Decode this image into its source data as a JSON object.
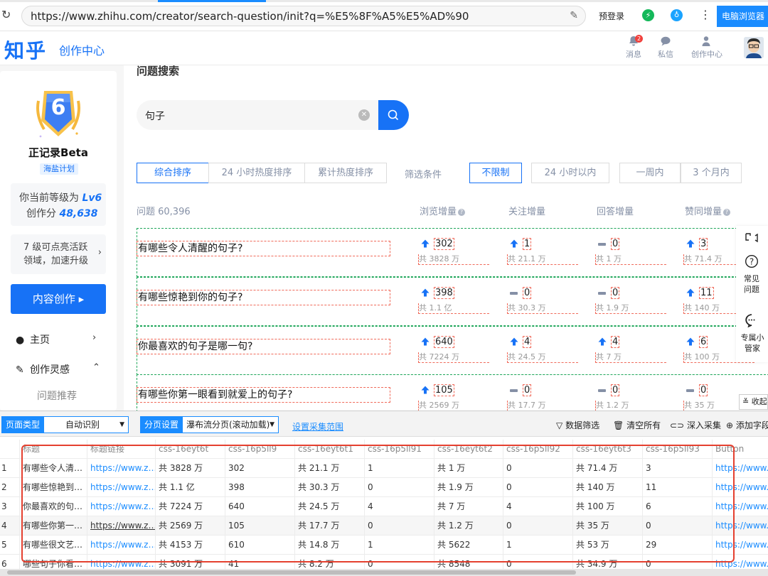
{
  "browser": {
    "url": "https://www.zhihu.com/creator/search-question/init?q=%E5%8F%A5%E5%AD%90",
    "prelogin": "预登录",
    "ext1": "⚡",
    "ext2": "♁",
    "menu": "⋮",
    "pc_browser": "电脑浏览器"
  },
  "header": {
    "logo": "知乎",
    "creator_center": "创作中心",
    "notifications": "消息",
    "notification_count": "2",
    "messages": "私信",
    "creator_link": "创作中心"
  },
  "sidebar": {
    "medal_level": "6",
    "level_title": "正记录Beta",
    "plan": "海盐计划",
    "level_prefix": "你当前等级为",
    "level_value": "Lv6",
    "score_prefix": "创作分",
    "score_value": "48,638",
    "tip": "7 级可点亮活跃领域，加速升级",
    "create_button": "内容创作 ▸",
    "nav_home": "主页",
    "nav_inspiration": "创作灵感",
    "nav_question_recommend": "问题推荐"
  },
  "main": {
    "title": "问题搜索",
    "search_value": "句子",
    "sort_tabs": [
      "综合排序",
      "24 小时热度排序",
      "累计热度排序"
    ],
    "filter_label": "筛选条件",
    "time_filters": [
      "不限制",
      "24 小时以内",
      "一周内",
      "3 个月内"
    ],
    "question_count": "问题 60,396",
    "columns": [
      "浏览增量",
      "关注增量",
      "回答增量",
      "赞同增量"
    ],
    "questions": [
      {
        "title": "有哪些令人清醒的句子?",
        "stats": [
          {
            "trend": "up",
            "value": "302",
            "total": "共 3828 万"
          },
          {
            "trend": "up",
            "value": "1",
            "total": "共 21.1 万"
          },
          {
            "trend": "flat",
            "value": "0",
            "total": "共 1 万"
          },
          {
            "trend": "up",
            "value": "3",
            "total": "共 71.4 万"
          }
        ]
      },
      {
        "title": "有哪些惊艳到你的句子?",
        "stats": [
          {
            "trend": "up",
            "value": "398",
            "total": "共 1.1 亿"
          },
          {
            "trend": "flat",
            "value": "0",
            "total": "共 30.3 万"
          },
          {
            "trend": "flat",
            "value": "0",
            "total": "共 1.9 万"
          },
          {
            "trend": "up",
            "value": "11",
            "total": "共 140 万"
          }
        ]
      },
      {
        "title": "你最喜欢的句子是哪一句?",
        "stats": [
          {
            "trend": "up",
            "value": "640",
            "total": "共 7224 万"
          },
          {
            "trend": "up",
            "value": "4",
            "total": "共 24.5 万"
          },
          {
            "trend": "up",
            "value": "4",
            "total": "共 7 万"
          },
          {
            "trend": "up",
            "value": "6",
            "total": "共 100 万"
          }
        ]
      },
      {
        "title": "有哪些你第一眼看到就爱上的句子?",
        "stats": [
          {
            "trend": "up",
            "value": "105",
            "total": "共 2569 万"
          },
          {
            "trend": "flat",
            "value": "0",
            "total": "共 17.7 万"
          },
          {
            "trend": "flat",
            "value": "0",
            "total": "共 1.2 万"
          },
          {
            "trend": "flat",
            "value": "0",
            "total": "共 35 万"
          }
        ]
      }
    ]
  },
  "rightfloat": {
    "faq": "常见问题",
    "assistant": "专属小管家",
    "collapse": "收起"
  },
  "scraper": {
    "page_type_label": "页面类型",
    "page_type_value": "自动识别",
    "paging_label": "分页设置",
    "paging_value": "瀑布流分页(滚动加载)",
    "set_range": "设置采集范围",
    "filter": "数据筛选",
    "clear": "清空所有",
    "deep": "深入采集",
    "add_field": "添加字段",
    "columns": [
      "标题",
      "标题链接",
      "css-16eyt6t",
      "css-16p5ll9",
      "css-16eyt6t1",
      "css-16p5ll91",
      "css-16eyt6t2",
      "css-16p5ll92",
      "css-16eyt6t3",
      "css-16p5ll93",
      "Button"
    ],
    "rows": [
      [
        "有哪些令人清…",
        "https://www.z…",
        "共 3828 万",
        "302",
        "共 21.1 万",
        "1",
        "共 1 万",
        "0",
        "共 71.4 万",
        "3",
        "https://www.z"
      ],
      [
        "有哪些惊艳到…",
        "https://www.z…",
        "共 1.1 亿",
        "398",
        "共 30.3 万",
        "0",
        "共 1.9 万",
        "0",
        "共 140 万",
        "11",
        "https://www.z"
      ],
      [
        "你最喜欢的句…",
        "https://www.z…",
        "共 7224 万",
        "640",
        "共 24.5 万",
        "4",
        "共 7 万",
        "4",
        "共 100 万",
        "6",
        "https://www.z"
      ],
      [
        "有哪些你第一…",
        "https://www.z…",
        "共 2569 万",
        "105",
        "共 17.7 万",
        "0",
        "共 1.2 万",
        "0",
        "共 35 万",
        "0",
        "https://www.z"
      ],
      [
        "有哪些很文艺…",
        "https://www.z…",
        "共 4153 万",
        "610",
        "共 14.8 万",
        "1",
        "共 5622",
        "1",
        "共 53 万",
        "29",
        "https://www.z"
      ],
      [
        "哪些句子你看…",
        "https://www.z…",
        "共 3091 万",
        "41",
        "共 8.2 万",
        "0",
        "共 8548",
        "0",
        "共 34.9 万",
        "0",
        "https://www.z"
      ]
    ],
    "row_numbers": [
      "1",
      "2",
      "3",
      "4",
      "5",
      "6"
    ]
  },
  "colors": {
    "brand": "#1772f6",
    "scraper_blue": "#1a8cff",
    "highlight_red": "#e5402f",
    "dash_green": "#1fa65a"
  }
}
